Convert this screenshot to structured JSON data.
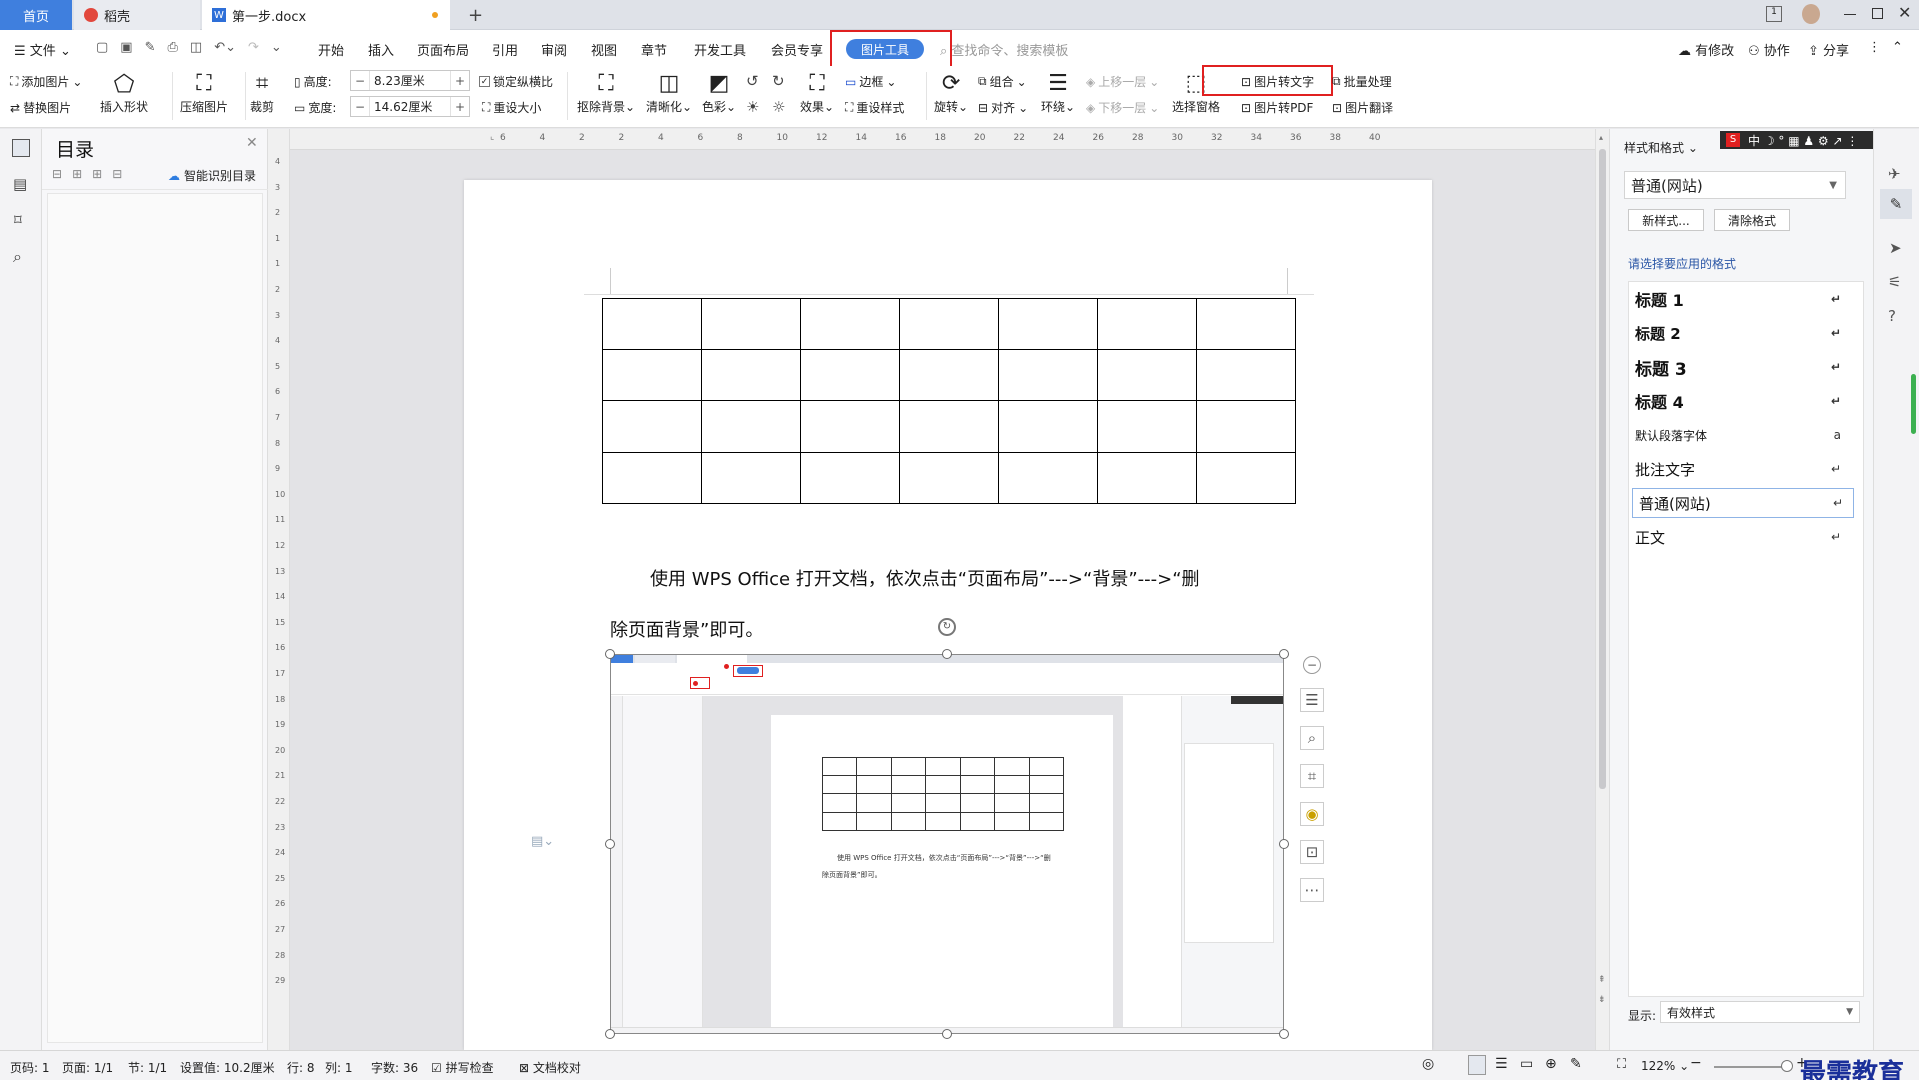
{
  "tabs": {
    "home": "首页",
    "daoke": "稻壳",
    "doc": "第一步.docx",
    "new_tab": "+"
  },
  "menu": {
    "file": "文件",
    "items": [
      "开始",
      "插入",
      "页面布局",
      "引用",
      "审阅",
      "视图",
      "章节",
      "开发工具",
      "会员专享"
    ],
    "active": "图片工具",
    "search_placeholder": "查找命令、搜索模板",
    "has_changes": "有修改",
    "collab": "协作",
    "share": "分享"
  },
  "ribbon": {
    "add_picture": "添加图片",
    "replace_picture": "替换图片",
    "insert_shape": "插入形状",
    "compress": "压缩图片",
    "crop": "裁剪",
    "height_label": "高度:",
    "height_value": "8.23厘米",
    "width_label": "宽度:",
    "width_value": "14.62厘米",
    "lock_ratio": "锁定纵横比",
    "reset_size": "重设大小",
    "remove_bg": "抠除背景",
    "sharpen": "清晰化",
    "color": "色彩",
    "effect": "效果",
    "border": "边框",
    "reset_style": "重设样式",
    "rotate": "旋转",
    "group": "组合",
    "align": "对齐",
    "wrap": "环绕",
    "bring_forward": "上移一层",
    "send_backward": "下移一层",
    "selection_pane": "选择窗格",
    "pic_to_text": "图片转文字",
    "pic_to_pdf": "图片转PDF",
    "batch": "批量处理",
    "translate": "图片翻译"
  },
  "toc": {
    "title": "目录",
    "smart": "智能识别目录"
  },
  "ruler": {
    "h": [
      "6",
      "4",
      "2",
      "2",
      "4",
      "6",
      "8",
      "10",
      "12",
      "14",
      "16",
      "18",
      "20",
      "22",
      "24",
      "26",
      "28",
      "30",
      "32",
      "34",
      "36",
      "38",
      "40"
    ],
    "v": [
      "4",
      "3",
      "2",
      "1",
      "1",
      "2",
      "3",
      "4",
      "5",
      "6",
      "7",
      "8",
      "9",
      "10",
      "11",
      "12",
      "13",
      "14",
      "15",
      "16",
      "17",
      "18",
      "19",
      "20",
      "21",
      "22",
      "23",
      "24",
      "25",
      "26",
      "27",
      "28",
      "29"
    ]
  },
  "doc": {
    "para_line1": "使用 WPS Office 打开文档，依次点击“页面布局”--->“背景”--->“删",
    "para_line2": "除页面背景”即可。",
    "mini_para1": "使用 WPS Office 打开文档，依次点击“页面布局”--->“背景”--->“删",
    "mini_para2": "除页面背景”即可。"
  },
  "stylepane": {
    "header": "样式和格式",
    "current": "普通(网站)",
    "new_style": "新样式...",
    "clear": "清除格式",
    "prompt": "请选择要应用的格式",
    "items": [
      "标题  1",
      "标题  2",
      "标题  3",
      "标题  4",
      "默认段落字体",
      "批注文字",
      "普通(网站)",
      "正文"
    ],
    "show_label": "显示:",
    "show_value": "有效样式"
  },
  "status": {
    "page_code": "页码: 1",
    "page": "页面: 1/1",
    "section": "节: 1/1",
    "setting": "设置值: 10.2厘米",
    "row": "行: 8",
    "col": "列: 1",
    "words": "字数: 36",
    "spell": "拼写检查",
    "proof": "文档校对",
    "zoom": "122%",
    "watermark": "最需教育"
  },
  "colors": {
    "accent": "#3f7fde",
    "red_highlight": "#e02020"
  }
}
